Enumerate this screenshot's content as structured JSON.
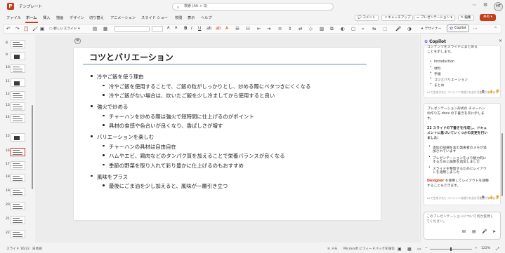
{
  "app": {
    "title": "テンプレート",
    "search_placeholder": "検索 (Alt + Q)",
    "user_initials": "HT"
  },
  "menu": {
    "items": [
      "ファイル",
      "ホーム",
      "挿入",
      "描画",
      "デザイン",
      "切り替え",
      "アニメーション",
      "スライド ショー",
      "校閲",
      "表示",
      "ヘルプ"
    ],
    "active": "ホーム"
  },
  "topbar": {
    "comment": "コメント",
    "catchup": "キャッチアップ",
    "present": "プレゼンテーション",
    "edit": "編集",
    "share": "共有"
  },
  "ribbon": {
    "new_slide": "新しいスライド",
    "designer": "デザイナー",
    "copilot": "Copilot"
  },
  "thumbnails": {
    "numbers": [
      "8",
      "9",
      "10",
      "11",
      "12",
      "13",
      "14",
      "15",
      "16",
      "17",
      "18",
      "19",
      "20",
      "21",
      "22"
    ],
    "selected": "16"
  },
  "slide": {
    "title": "コツとバリエーション",
    "sections": [
      {
        "heading": "冷やご飯を使う理由",
        "items": [
          "冷やご飯を使用することで、ご飯の粒がしっかりとし、炒める際にベタつきにくくなる",
          "冷やご飯がない場合は、炊いたご飯を少し冷ましてから使用すると良い"
        ]
      },
      {
        "heading": "強火で炒める",
        "items": [
          "チャーハンを炒める際は強火で短時間に仕上げるのがポイント",
          "具材の食感や色合いが良くなり、香ばしさが増す"
        ]
      },
      {
        "heading": "バリエーションを楽しむ",
        "items": [
          "チャーハンの具材は自由自在",
          "ハムやエビ、鶏肉などのタンパク質を加えることで栄養バランスが良くなる",
          "季節の野菜を取り入れて彩り豊かに仕上げるのもおすすめ"
        ]
      },
      {
        "heading": "風味をプラス",
        "items": [
          "最後にごま油を少し加えると、風味が一層引き立つ"
        ]
      }
    ]
  },
  "copilot": {
    "title": "Copilot",
    "card1": {
      "lines": [
        "コンテンツをスライドにまとめる",
        "ことを示します。"
      ],
      "bullets": [
        "Introduction",
        "材料",
        "手順",
        "コツとバリエーション",
        "まとめ"
      ],
      "disclaimer": "AI で生成された コンテンツは誤りを含む可能性があります"
    },
    "card2": {
      "intro": [
        "プレゼンテーション形式の チャーハン",
        "の作り方.docx の下書きを次に示しま",
        "す。"
      ],
      "summary": [
        "22 スライドの下書きを作成し、ドキュ",
        "メントに基づいていくつかの変更を行い",
        "ました:"
      ],
      "bullets": [
        [
          "追加の詳細を含む発表者のメモが追",
          "加されています"
        ],
        [
          "プレゼンテーションをより魅力的に",
          "するために画像を追加しました"
        ],
        [
          "スライドを整理するためにレイアウ",
          "トを適用しました"
        ]
      ],
      "designer_link": "Designer",
      "designer_rest": "を使用してレイアウトを調整",
      "designer_line2": "することもできます。",
      "disclaimer": "AI で生成された コンテンツは誤りを含む可能性があります"
    },
    "input_placeholder": "このプレゼンテーションについて何か質問してください。"
  },
  "status": {
    "slide": "スライド 16/22",
    "lang": "日本語",
    "feedback": "Microsoft にフィードバックを送信",
    "notes": "メモ",
    "zoom": "122%"
  },
  "colors": {
    "accent": "#c43e1c",
    "title_rule": "#5b8fbf"
  }
}
